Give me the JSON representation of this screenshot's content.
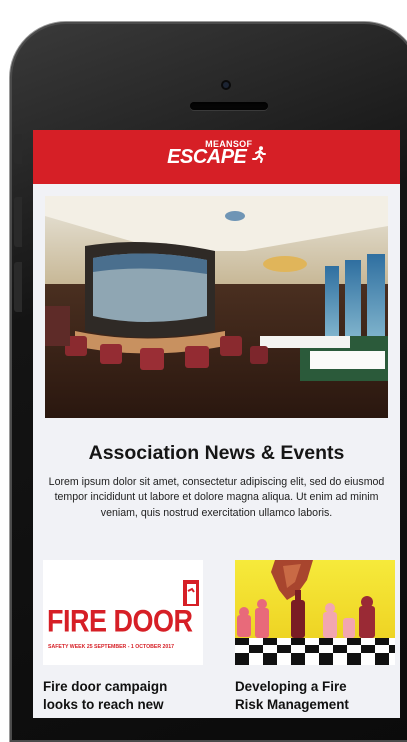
{
  "header": {
    "logo_small": "MEANSOF",
    "logo_big": "ESCAPE",
    "logo_icon": "running-figure-icon",
    "brand_color": "#d61f26"
  },
  "hero": {
    "image": "restaurant-interior-photo"
  },
  "section": {
    "title": "Association News & Events",
    "body": "Lorem ipsum dolor sit amet, consectetur adipiscing elit, sed do eiusmod tempor incididunt ut labore et dolore magna aliqua. Ut enim ad minim veniam, quis nostrud exercitation ullamco laboris."
  },
  "cards": [
    {
      "image_title": "FIRE DOOR",
      "image_subtitle": "SAFETY WEEK 25 SEPTEMBER - 1 OCTOBER 2017",
      "icon": "fire-door-exit-icon",
      "title_line1": "Fire door campaign",
      "title_line2": "looks to reach new"
    },
    {
      "image": "chess-pieces-hand-illustration",
      "title_line1": "Developing a Fire",
      "title_line2": "Risk Management"
    }
  ]
}
